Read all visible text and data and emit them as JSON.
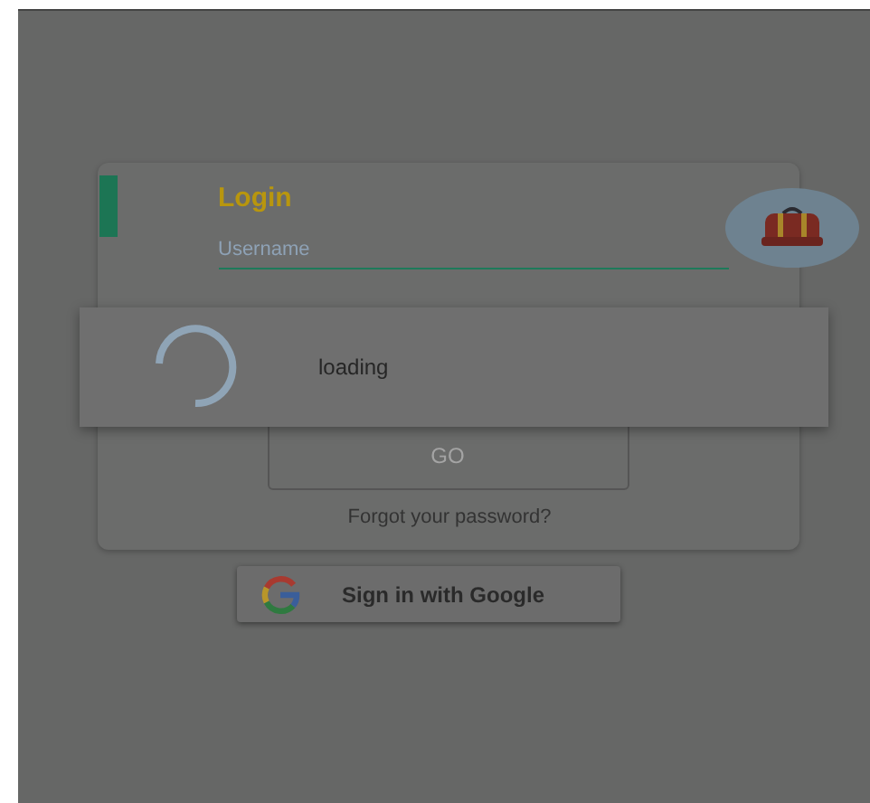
{
  "login_card": {
    "title": "Login",
    "username": {
      "placeholder": "Username"
    },
    "go_button": "GO",
    "forgot_link": "Forgot your password?"
  },
  "google_button": {
    "label": "Sign in with Google"
  },
  "loading_dialog": {
    "message": "loading"
  }
}
